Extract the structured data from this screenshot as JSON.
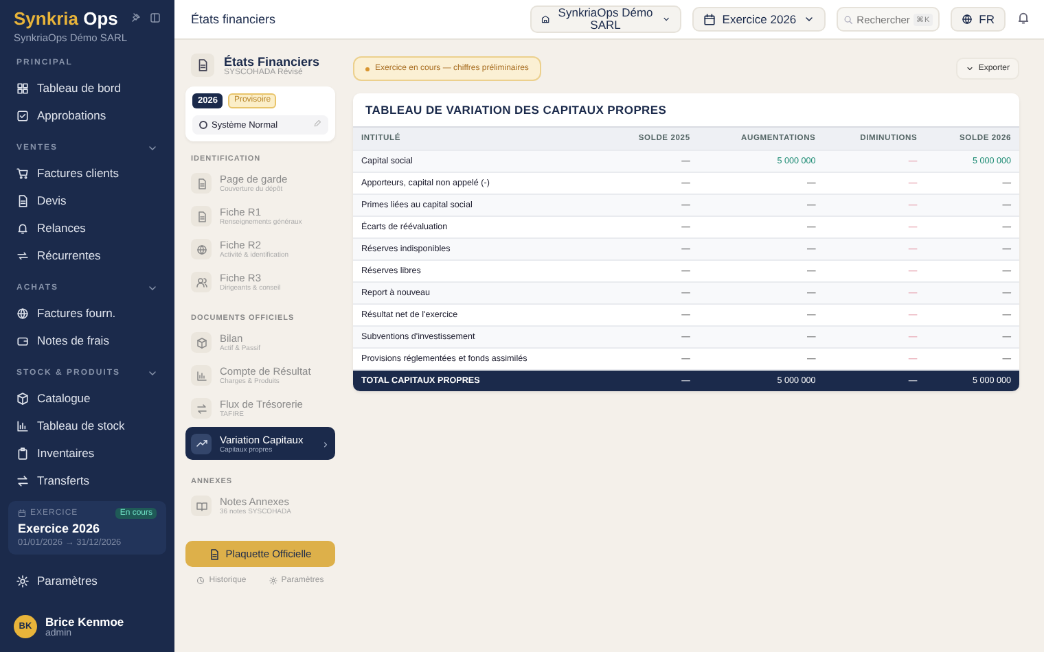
{
  "brand": {
    "name_a": "Synkria",
    "name_b": "Ops",
    "company": "SynkriaOps Démo SARL"
  },
  "nav": [
    {
      "label": "PRINCIPAL",
      "items": [
        {
          "label": "Tableau de bord"
        },
        {
          "label": "Approbations"
        }
      ]
    },
    {
      "label": "VENTES",
      "expanded": true,
      "items": [
        {
          "label": "Factures clients"
        },
        {
          "label": "Devis"
        },
        {
          "label": "Relances"
        },
        {
          "label": "Récurrentes"
        }
      ]
    },
    {
      "label": "ACHATS",
      "expanded": true,
      "items": [
        {
          "label": "Factures fourn."
        },
        {
          "label": "Notes de frais"
        }
      ]
    },
    {
      "label": "STOCK & PRODUITS",
      "expanded": true,
      "items": [
        {
          "label": "Catalogue"
        },
        {
          "label": "Tableau de stock"
        },
        {
          "label": "Inventaires"
        },
        {
          "label": "Transferts"
        }
      ]
    }
  ],
  "exercise_card": {
    "label": "EXERCICE",
    "badge": "En cours",
    "title": "Exercice 2026",
    "range": "01/01/2026 → 31/12/2026"
  },
  "settings_link": "Paramètres",
  "user": {
    "initials": "BK",
    "name": "Brice Kenmoe",
    "role": "admin"
  },
  "topbar": {
    "title": "États financiers",
    "company": "SynkriaOps Démo SARL",
    "exercise": "Exercice 2026",
    "search_placeholder": "Rechercher",
    "shortcut": "⌘K",
    "language": "FR"
  },
  "statements": {
    "title": "États Financiers",
    "subtitle": "SYSCOHADA Révisé",
    "year": "2026",
    "status": "Provisoire",
    "system": "Système Normal",
    "groups": [
      {
        "label": "IDENTIFICATION",
        "items": [
          {
            "title": "Page de garde",
            "subtitle": "Couverture du dépôt",
            "selected": false
          },
          {
            "title": "Fiche R1",
            "subtitle": "Renseignements généraux",
            "selected": false
          },
          {
            "title": "Fiche R2",
            "subtitle": "Activité & identification",
            "selected": false
          },
          {
            "title": "Fiche R3",
            "subtitle": "Dirigeants & conseil",
            "selected": false
          }
        ]
      },
      {
        "label": "DOCUMENTS OFFICIELS",
        "items": [
          {
            "title": "Bilan",
            "subtitle": "Actif & Passif",
            "selected": false
          },
          {
            "title": "Compte de Résultat",
            "subtitle": "Charges & Produits",
            "selected": false
          },
          {
            "title": "Flux de Trésorerie",
            "subtitle": "TAFIRE",
            "selected": false
          },
          {
            "title": "Variation Capitaux",
            "subtitle": "Capitaux propres",
            "selected": true
          }
        ]
      },
      {
        "label": "ANNEXES",
        "items": [
          {
            "title": "Notes Annexes",
            "subtitle": "36 notes SYSCOHADA",
            "selected": false
          }
        ]
      }
    ],
    "primary_button": "Plaquette Officielle",
    "links": [
      "Historique",
      "Paramètres"
    ]
  },
  "notice": "Exercice en cours — chiffres préliminaires",
  "export_button": "Exporter",
  "table": {
    "title": "TABLEAU DE VARIATION DES CAPITAUX PROPRES",
    "columns": [
      {
        "label": "INTITULÉ",
        "kind": "label"
      },
      {
        "label": "SOLDE 2025",
        "kind": "neutral"
      },
      {
        "label": "AUGMENTATIONS",
        "kind": "increase"
      },
      {
        "label": "DIMINUTIONS",
        "kind": "decrease"
      },
      {
        "label": "SOLDE 2026",
        "kind": "increase"
      }
    ],
    "rows": [
      [
        "Capital social",
        "—",
        "5 000 000",
        "—",
        "5 000 000"
      ],
      [
        "Apporteurs, capital non appelé (-)",
        "—",
        "—",
        "—",
        "—"
      ],
      [
        "Primes liées au capital social",
        "—",
        "—",
        "—",
        "—"
      ],
      [
        "Écarts de réévaluation",
        "—",
        "—",
        "—",
        "—"
      ],
      [
        "Réserves indisponibles",
        "—",
        "—",
        "—",
        "—"
      ],
      [
        "Réserves libres",
        "—",
        "—",
        "—",
        "—"
      ],
      [
        "Report à nouveau",
        "—",
        "—",
        "—",
        "—"
      ],
      [
        "Résultat net de l'exercice",
        "—",
        "—",
        "—",
        "—"
      ],
      [
        "Subventions d'investissement",
        "—",
        "—",
        "—",
        "—"
      ],
      [
        "Provisions réglementées et fonds assimilés",
        "—",
        "—",
        "—",
        "—"
      ]
    ],
    "total": [
      "TOTAL CAPITAUX PROPRES",
      "—",
      "5 000 000",
      "—",
      "5 000 000"
    ]
  }
}
